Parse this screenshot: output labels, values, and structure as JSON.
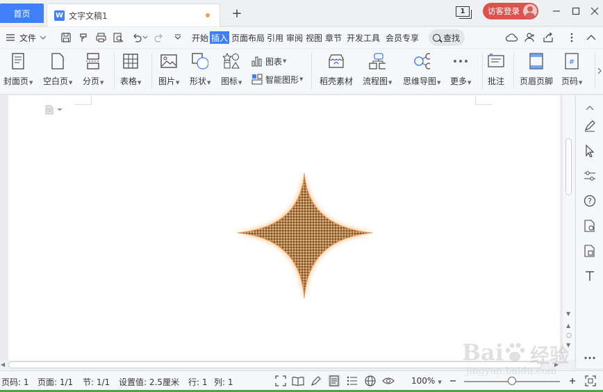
{
  "titlebar": {
    "home_tab": "首页",
    "doc_tab": "文字文稿1",
    "doc_icon_letter": "W",
    "new_tab": "+",
    "window_count": "1",
    "login_label": "访客登录"
  },
  "menu": {
    "file": "文件",
    "items": [
      "开始",
      "插入",
      "页面布局",
      "引用",
      "审阅",
      "视图",
      "章节",
      "开发工具",
      "会员专享"
    ],
    "active": "插入",
    "search": "查找"
  },
  "ribbon": {
    "cover": "封面页",
    "blank": "空白页",
    "page_break": "分页",
    "table": "表格",
    "picture": "图片",
    "shape": "形状",
    "icon": "图标",
    "chart": "图表",
    "smart_shape": "智能图形",
    "docer": "稻壳素材",
    "flowchart": "流程图",
    "mindmap": "思维导图",
    "more": "更多",
    "comment": "批注",
    "header_footer": "页眉页脚",
    "page_number": "页码"
  },
  "status": {
    "page_num": "页码: 1",
    "pages": "页面: 1/1",
    "section": "节: 1/1",
    "setting": "设置值: 2.5厘米",
    "row": "行: 1",
    "col": "列: 1",
    "zoom": "100%"
  },
  "watermark": {
    "brand_latin": "Bai",
    "brand_han": "经验",
    "url": "jingyan.baidu.com"
  },
  "colors": {
    "accent": "#3f7ff7",
    "login": "#d9534f",
    "star_glow": "#f7a85a",
    "star_fill": "#9a6a3e"
  }
}
